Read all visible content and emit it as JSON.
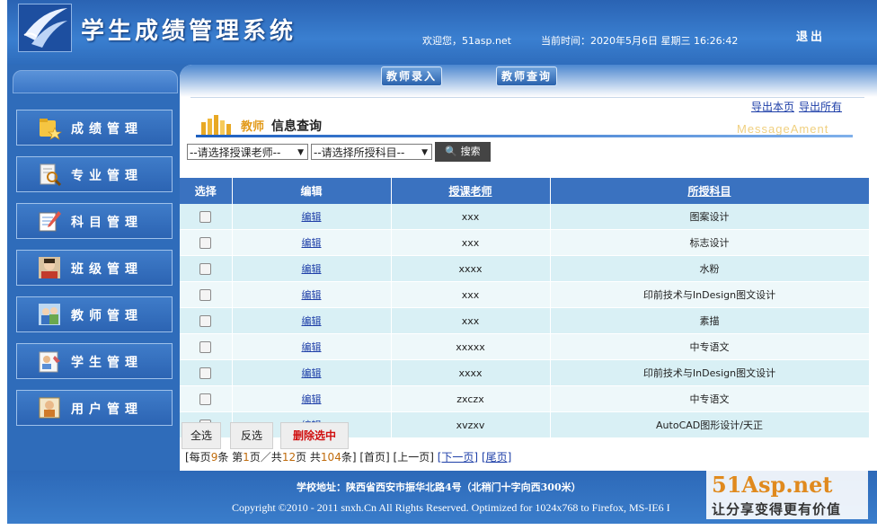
{
  "header": {
    "title": "学生成绩管理系统",
    "welcome": "欢迎您，51asp.net",
    "current_time": "当前时间：2020年5月6日 星期三 16:26:42",
    "logout": "退出"
  },
  "sidebar": {
    "items": [
      {
        "label": "成绩管理",
        "icon": "folder-star-icon"
      },
      {
        "label": "专业管理",
        "icon": "search-document-icon"
      },
      {
        "label": "科目管理",
        "icon": "edit-note-icon"
      },
      {
        "label": "班级管理",
        "icon": "person-avatar-icon"
      },
      {
        "label": "教师管理",
        "icon": "teacher-group-icon"
      },
      {
        "label": "学生管理",
        "icon": "student-card-icon"
      },
      {
        "label": "用户管理",
        "icon": "user-profile-icon"
      }
    ]
  },
  "main": {
    "tabs": [
      "教师录入",
      "教师查询"
    ],
    "export_page": "导出本页",
    "export_all": "导出所有",
    "section_title_a": "教师",
    "section_title_b": "信息查询",
    "section_subtitle": "MessageAment",
    "filter_teacher": "--请选择授课老师--",
    "filter_subject": "--请选择所授科目--",
    "search_label": "搜索"
  },
  "table": {
    "headers": [
      "选择",
      "编辑",
      "授课老师",
      "所授科目"
    ],
    "edit_label": "编辑",
    "rows": [
      {
        "teacher": "xxx",
        "subject": "图案设计"
      },
      {
        "teacher": "xxx",
        "subject": "标志设计"
      },
      {
        "teacher": "xxxx",
        "subject": "水粉"
      },
      {
        "teacher": "xxx",
        "subject": "印前技术与InDesign图文设计"
      },
      {
        "teacher": "xxx",
        "subject": "素描"
      },
      {
        "teacher": "xxxxx",
        "subject": "中专语文"
      },
      {
        "teacher": "xxxx",
        "subject": "印前技术与InDesign图文设计"
      },
      {
        "teacher": "zxczx",
        "subject": "中专语文"
      },
      {
        "teacher": "xvzxv",
        "subject": "AutoCAD图形设计/天正"
      }
    ]
  },
  "actions": {
    "select_all": "全选",
    "invert": "反选",
    "delete_selected": "删除选中"
  },
  "pager": {
    "per_page_prefix": "[每页",
    "per_page": "9",
    "per_page_suffix": "条 第",
    "page": "1",
    "page_sep": "页／共",
    "total_pages": "12",
    "total_sep": "页 共",
    "total_items": "104",
    "total_suffix": "条]",
    "first": "[首页]",
    "prev": "[上一页]",
    "next": "[下一页]",
    "last": "[尾页]"
  },
  "footer": {
    "address": "学校地址：陕西省西安市振华北路4号（北稍门十字向西300米）",
    "copyright": "Copyright ©2010 - 2011 snxh.Cn All Rights Reserved. Optimized for 1024x768 to Firefox, MS-IE6 I"
  },
  "watermark": {
    "brand": "51Asp.net",
    "slogan": "让分享变得更有价值"
  },
  "colors": {
    "primary_blue": "#2f6cba",
    "header_blue": "#3a72c0",
    "row_light": "#d9f0f5",
    "row_lighter": "#eef8fa",
    "delete_red": "#d01010",
    "watermark_orange": "#e08a1e"
  }
}
